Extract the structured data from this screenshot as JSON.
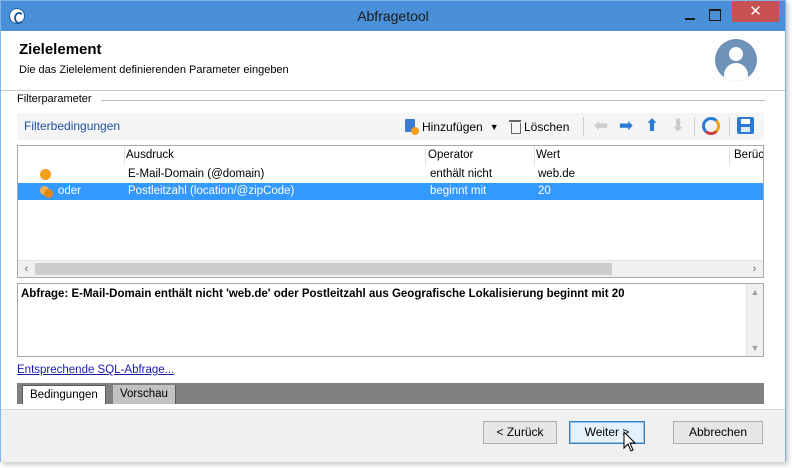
{
  "window": {
    "title": "Abfragetool",
    "close_glyph": "✕"
  },
  "header": {
    "title": "Zielelement",
    "subtitle": "Die das Zielelement definierenden Parameter eingeben"
  },
  "group": {
    "label": "Filterparameter"
  },
  "toolbar": {
    "filter_link": "Filterbedingungen",
    "add_label": "Hinzufügen",
    "delete_label": "Löschen",
    "icons": [
      "add-icon",
      "trash-icon",
      "arrow-left-icon",
      "arrow-right-icon",
      "arrow-up-icon",
      "arrow-down-icon",
      "refresh-icon",
      "save-icon"
    ]
  },
  "grid": {
    "columns": [
      "Ausdruck",
      "Operator",
      "Wert",
      "Berüc"
    ],
    "rows": [
      {
        "link": "",
        "expression": "E-Mail-Domain (@domain)",
        "operator": "enthält nicht",
        "value": "web.de",
        "selected": false
      },
      {
        "link": "oder",
        "expression": "Postleitzahl (location/@zipCode)",
        "operator": "beginnt mit",
        "value": "20",
        "selected": true
      }
    ]
  },
  "summary": {
    "text": "Abfrage: E-Mail-Domain enthält nicht 'web.de' oder Postleitzahl aus Geografische Lokalisierung beginnt mit 20"
  },
  "sql_link": "Entsprechende SQL-Abfrage...",
  "tabs": [
    {
      "label": "Bedingungen",
      "active": true
    },
    {
      "label": "Vorschau",
      "active": false
    }
  ],
  "buttons": {
    "back": "< Zurück",
    "next": "Weiter >",
    "cancel": "Abbrechen"
  },
  "colors": {
    "titlebar": "#4a90d9",
    "selection": "#3399ff",
    "accent_orange": "#f29d1b",
    "link_blue": "#1a4f9c"
  }
}
